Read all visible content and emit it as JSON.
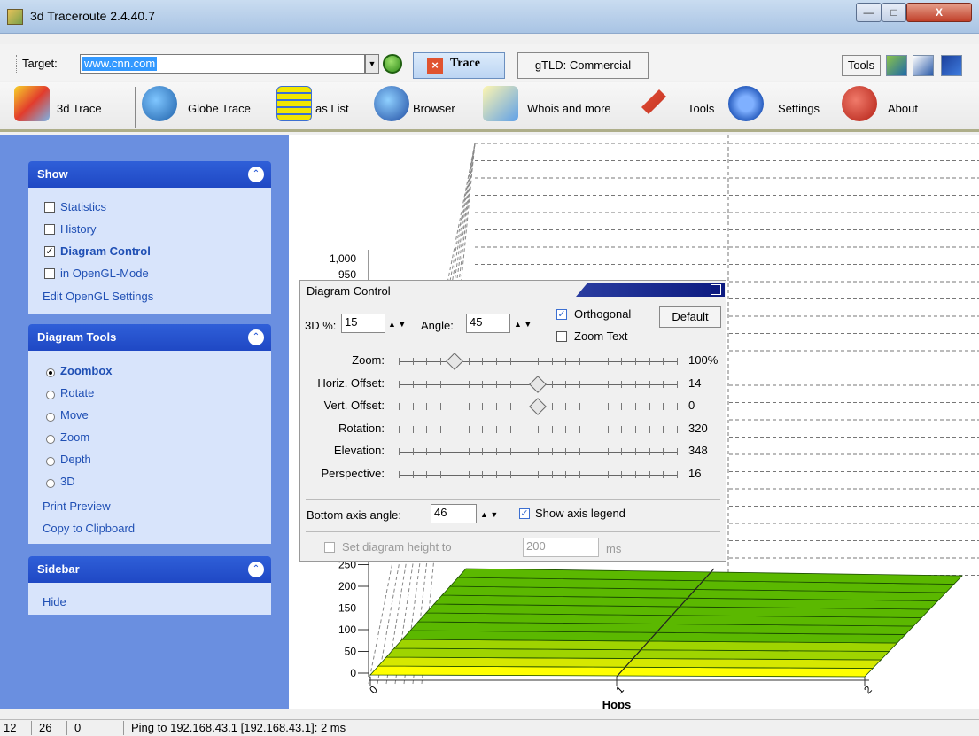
{
  "window": {
    "title": "3d Traceroute 2.4.40.7",
    "min_label": "—",
    "max_label": "□",
    "close_label": "X"
  },
  "target_bar": {
    "label": "Target:",
    "value": "www.cnn.com",
    "trace_label": "Trace",
    "gtld_label": "gTLD: Commercial",
    "tools_label": "Tools"
  },
  "toolbar": {
    "items": [
      {
        "label": "3d Trace"
      },
      {
        "label": "Globe Trace"
      },
      {
        "label": "as List"
      },
      {
        "label": "Browser"
      },
      {
        "label": "Whois and more"
      },
      {
        "label": "Tools"
      },
      {
        "label": "Settings"
      },
      {
        "label": "About"
      }
    ]
  },
  "sidebar": {
    "show": {
      "title": "Show",
      "items": [
        {
          "label": "Statistics",
          "checked": false
        },
        {
          "label": "History",
          "checked": false
        },
        {
          "label": "Diagram Control",
          "checked": true
        },
        {
          "label": "in OpenGL-Mode",
          "checked": false
        }
      ],
      "link": "Edit OpenGL Settings"
    },
    "tools": {
      "title": "Diagram Tools",
      "radios": [
        {
          "label": "Zoombox",
          "selected": true
        },
        {
          "label": "Rotate",
          "selected": false
        },
        {
          "label": "Move",
          "selected": false
        },
        {
          "label": "Zoom",
          "selected": false
        },
        {
          "label": "Depth",
          "selected": false
        },
        {
          "label": "3D",
          "selected": false
        }
      ],
      "links": [
        "Print Preview",
        "Copy to Clipboard"
      ]
    },
    "sidebar_panel": {
      "title": "Sidebar",
      "link": "Hide"
    }
  },
  "diagram_control": {
    "title": "Diagram Control",
    "pct_label": "3D %:",
    "pct_value": "15",
    "angle_label": "Angle:",
    "angle_value": "45",
    "orthogonal_label": "Orthogonal",
    "orthogonal_checked": true,
    "zoom_text_label": "Zoom Text",
    "zoom_text_checked": false,
    "default_label": "Default",
    "sliders": [
      {
        "label": "Zoom:",
        "value": "100%",
        "pos": 0.2
      },
      {
        "label": "Horiz. Offset:",
        "value": "14",
        "pos": 0.5
      },
      {
        "label": "Vert. Offset:",
        "value": "0",
        "pos": 0.5
      },
      {
        "label": "Rotation:",
        "value": "320",
        "pos": null
      },
      {
        "label": "Elevation:",
        "value": "348",
        "pos": null
      },
      {
        "label": "Perspective:",
        "value": "16",
        "pos": null
      }
    ],
    "bottom_axis_label": "Bottom axis angle:",
    "bottom_axis_value": "46",
    "show_legend_label": "Show axis legend",
    "show_legend_checked": true,
    "set_height_label": "Set diagram height to",
    "height_value": "200",
    "height_unit": "ms"
  },
  "chart_data": {
    "type": "area",
    "title": "",
    "xlabel": "Hops",
    "ylabel": "",
    "x": [
      0,
      1,
      2
    ],
    "x_tick_labels": [
      "0",
      "1",
      "2"
    ],
    "y_tick_labels": [
      "0",
      "50",
      "100",
      "150",
      "200",
      "250",
      "1,000",
      "950"
    ],
    "ylim": [
      0,
      1000
    ],
    "colors": {
      "low": "#ffff00",
      "high": "#2e9e00"
    }
  },
  "status": {
    "cells": [
      "12",
      "26",
      "0"
    ],
    "message": "Ping to 192.168.43.1 [192.168.43.1]: 2 ms"
  }
}
